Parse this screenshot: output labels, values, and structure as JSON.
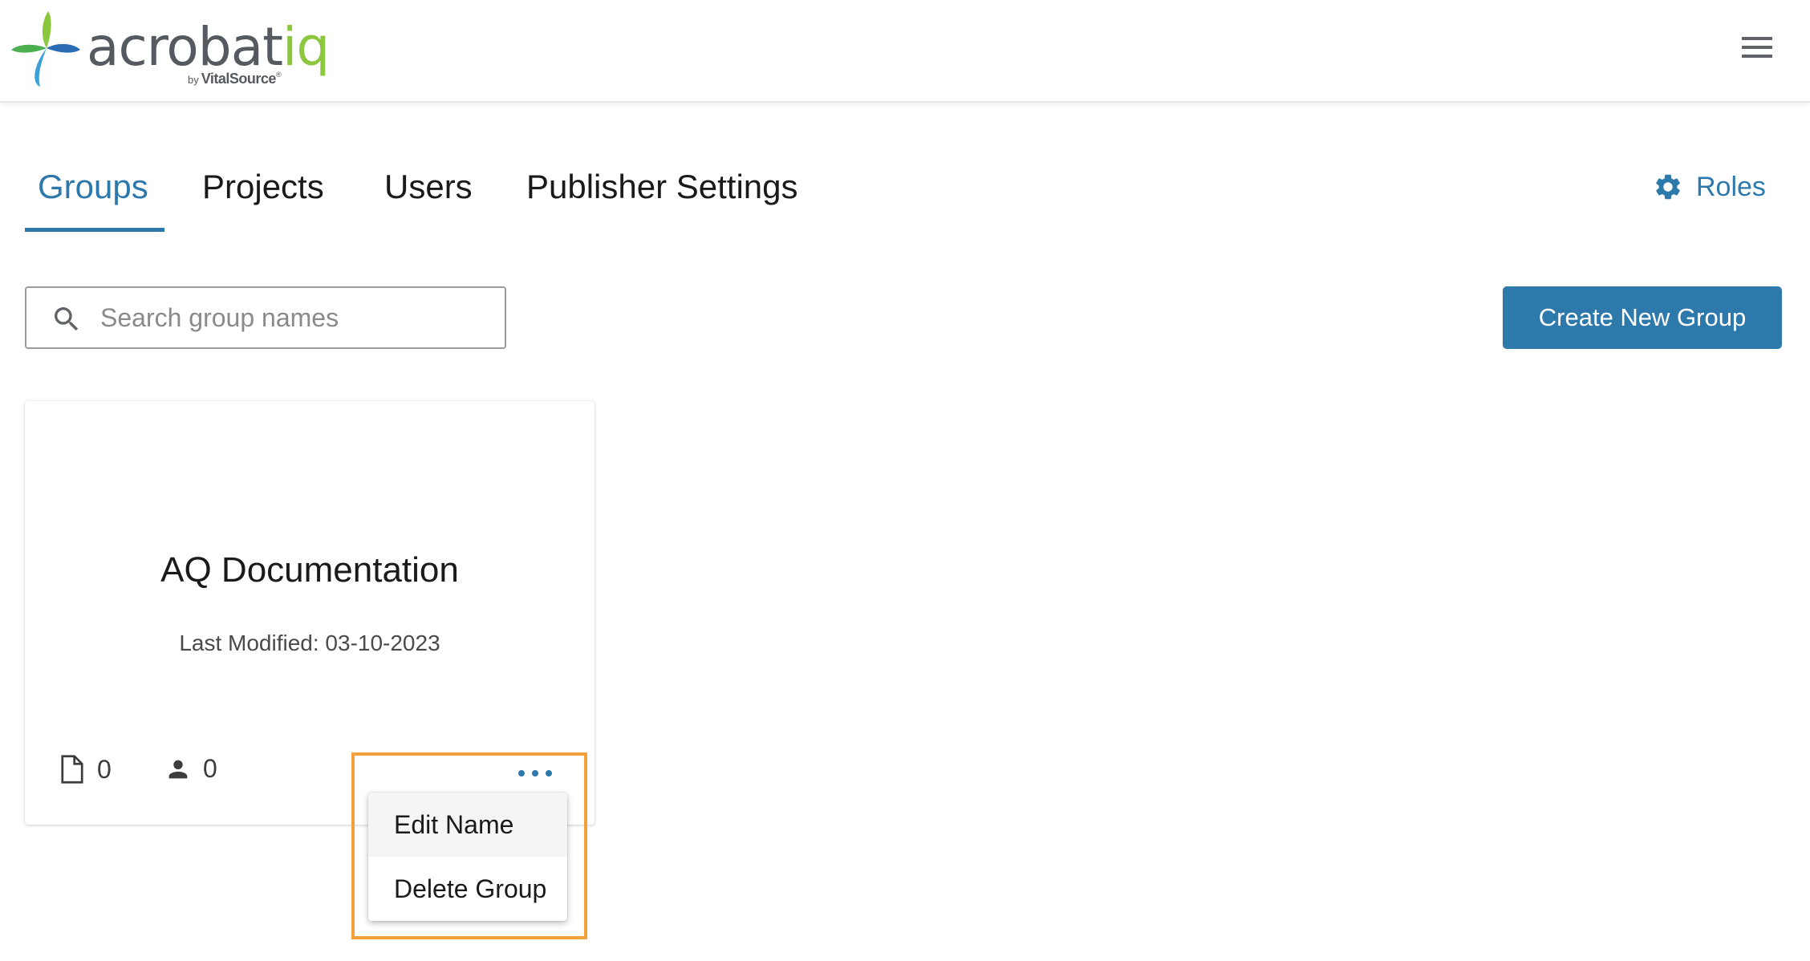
{
  "header": {
    "logo_main": "acrobat",
    "logo_accent": "iq",
    "logo_by": "by",
    "logo_vendor": "VitalSource",
    "logo_mark": "®",
    "menu_icon": "hamburger-menu-icon"
  },
  "tabs": [
    {
      "label": "Groups",
      "active": true
    },
    {
      "label": "Projects",
      "active": false
    },
    {
      "label": "Users",
      "active": false
    },
    {
      "label": "Publisher Settings",
      "active": false
    }
  ],
  "roles": {
    "label": "Roles",
    "icon": "gear-icon"
  },
  "search": {
    "placeholder": "Search group names",
    "value": "",
    "icon": "search-icon"
  },
  "create_button": {
    "label": "Create New Group"
  },
  "groups": [
    {
      "name": "AQ Documentation",
      "last_modified": "Last Modified: 03-10-2023",
      "projects_count": "0",
      "users_count": "0"
    }
  ],
  "more_menu": {
    "icon": "more-horizontal-icon",
    "items": [
      {
        "label": "Edit Name"
      },
      {
        "label": "Delete Group"
      }
    ]
  },
  "colors": {
    "accent": "#2e79ac",
    "highlight": "#f5a13b",
    "logo_green": "#8dc63f",
    "logo_blue": "#2a6cb4",
    "logo_gray": "#555a60"
  }
}
